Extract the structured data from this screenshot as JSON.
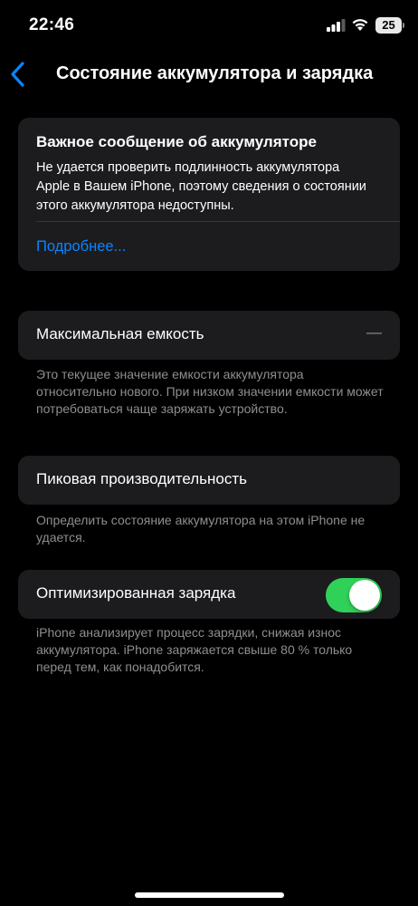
{
  "status_bar": {
    "time": "22:46",
    "battery_level": "25",
    "icons": [
      "signal-icon",
      "wifi-icon",
      "battery-icon"
    ]
  },
  "nav": {
    "back_icon": "chevron-left-icon",
    "title": "Состояние аккумулятора и зарядка"
  },
  "important_message": {
    "title": "Важное сообщение об аккумуляторе",
    "body": "Не удается проверить подлинность аккумулятора Apple в Вашем iPhone, поэтому сведения о состоянии этого аккумулятора недоступны.",
    "link": "Подробнее..."
  },
  "max_capacity": {
    "label": "Максимальная емкость",
    "value": "—",
    "footnote": "Это текущее значение емкости аккумулятора относительно нового. При низком значении емкости может потребоваться чаще заряжать устройство."
  },
  "peak_performance": {
    "label": "Пиковая производительность",
    "footnote": "Определить состояние аккумулятора на этом iPhone не удается."
  },
  "optimized_charging": {
    "label": "Оптимизированная зарядка",
    "enabled": true,
    "footnote": "iPhone анализирует процесс зарядки, снижая износ аккумулятора. iPhone заряжается свыше 80 % только перед тем, как понадобится."
  },
  "colors": {
    "accent": "#0a84ff",
    "toggle_on": "#30d158",
    "card": "#1c1c1e",
    "secondary_text": "#8e8e93"
  }
}
